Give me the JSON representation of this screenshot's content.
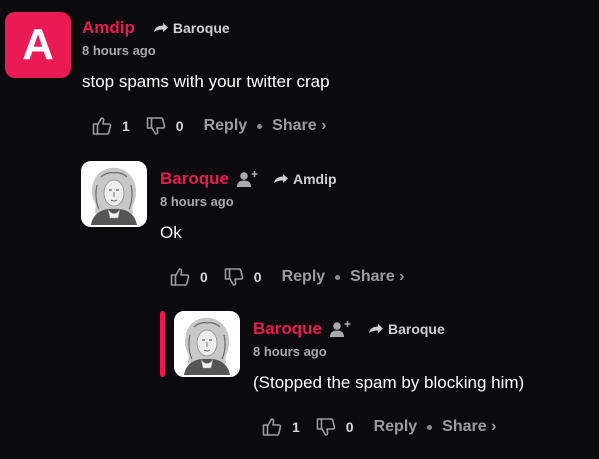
{
  "comments": [
    {
      "avatar_letter": "A",
      "author": "Amdip",
      "reply_to": "Baroque",
      "time": "8 hours ago",
      "text": "stop spams with your twitter crap",
      "likes": "1",
      "dislikes": "0",
      "reply_label": "Reply",
      "share_label": "Share ›"
    },
    {
      "author": "Baroque",
      "reply_to": "Amdip",
      "time": "8 hours ago",
      "text": "Ok",
      "likes": "0",
      "dislikes": "0",
      "reply_label": "Reply",
      "share_label": "Share ›"
    },
    {
      "author": "Baroque",
      "reply_to": "Baroque",
      "time": "8 hours ago",
      "text": "(Stopped the spam by blocking him)",
      "likes": "1",
      "dislikes": "0",
      "reply_label": "Reply",
      "share_label": "Share ›"
    }
  ],
  "colors": {
    "accent": "#ea1a54",
    "background": "#0b0b0d",
    "muted_text": "#9c9ca1"
  },
  "icons": [
    "reply-arrow-icon",
    "follow-user-icon",
    "thumbs-up-icon",
    "thumbs-down-icon",
    "portrait-avatar"
  ]
}
